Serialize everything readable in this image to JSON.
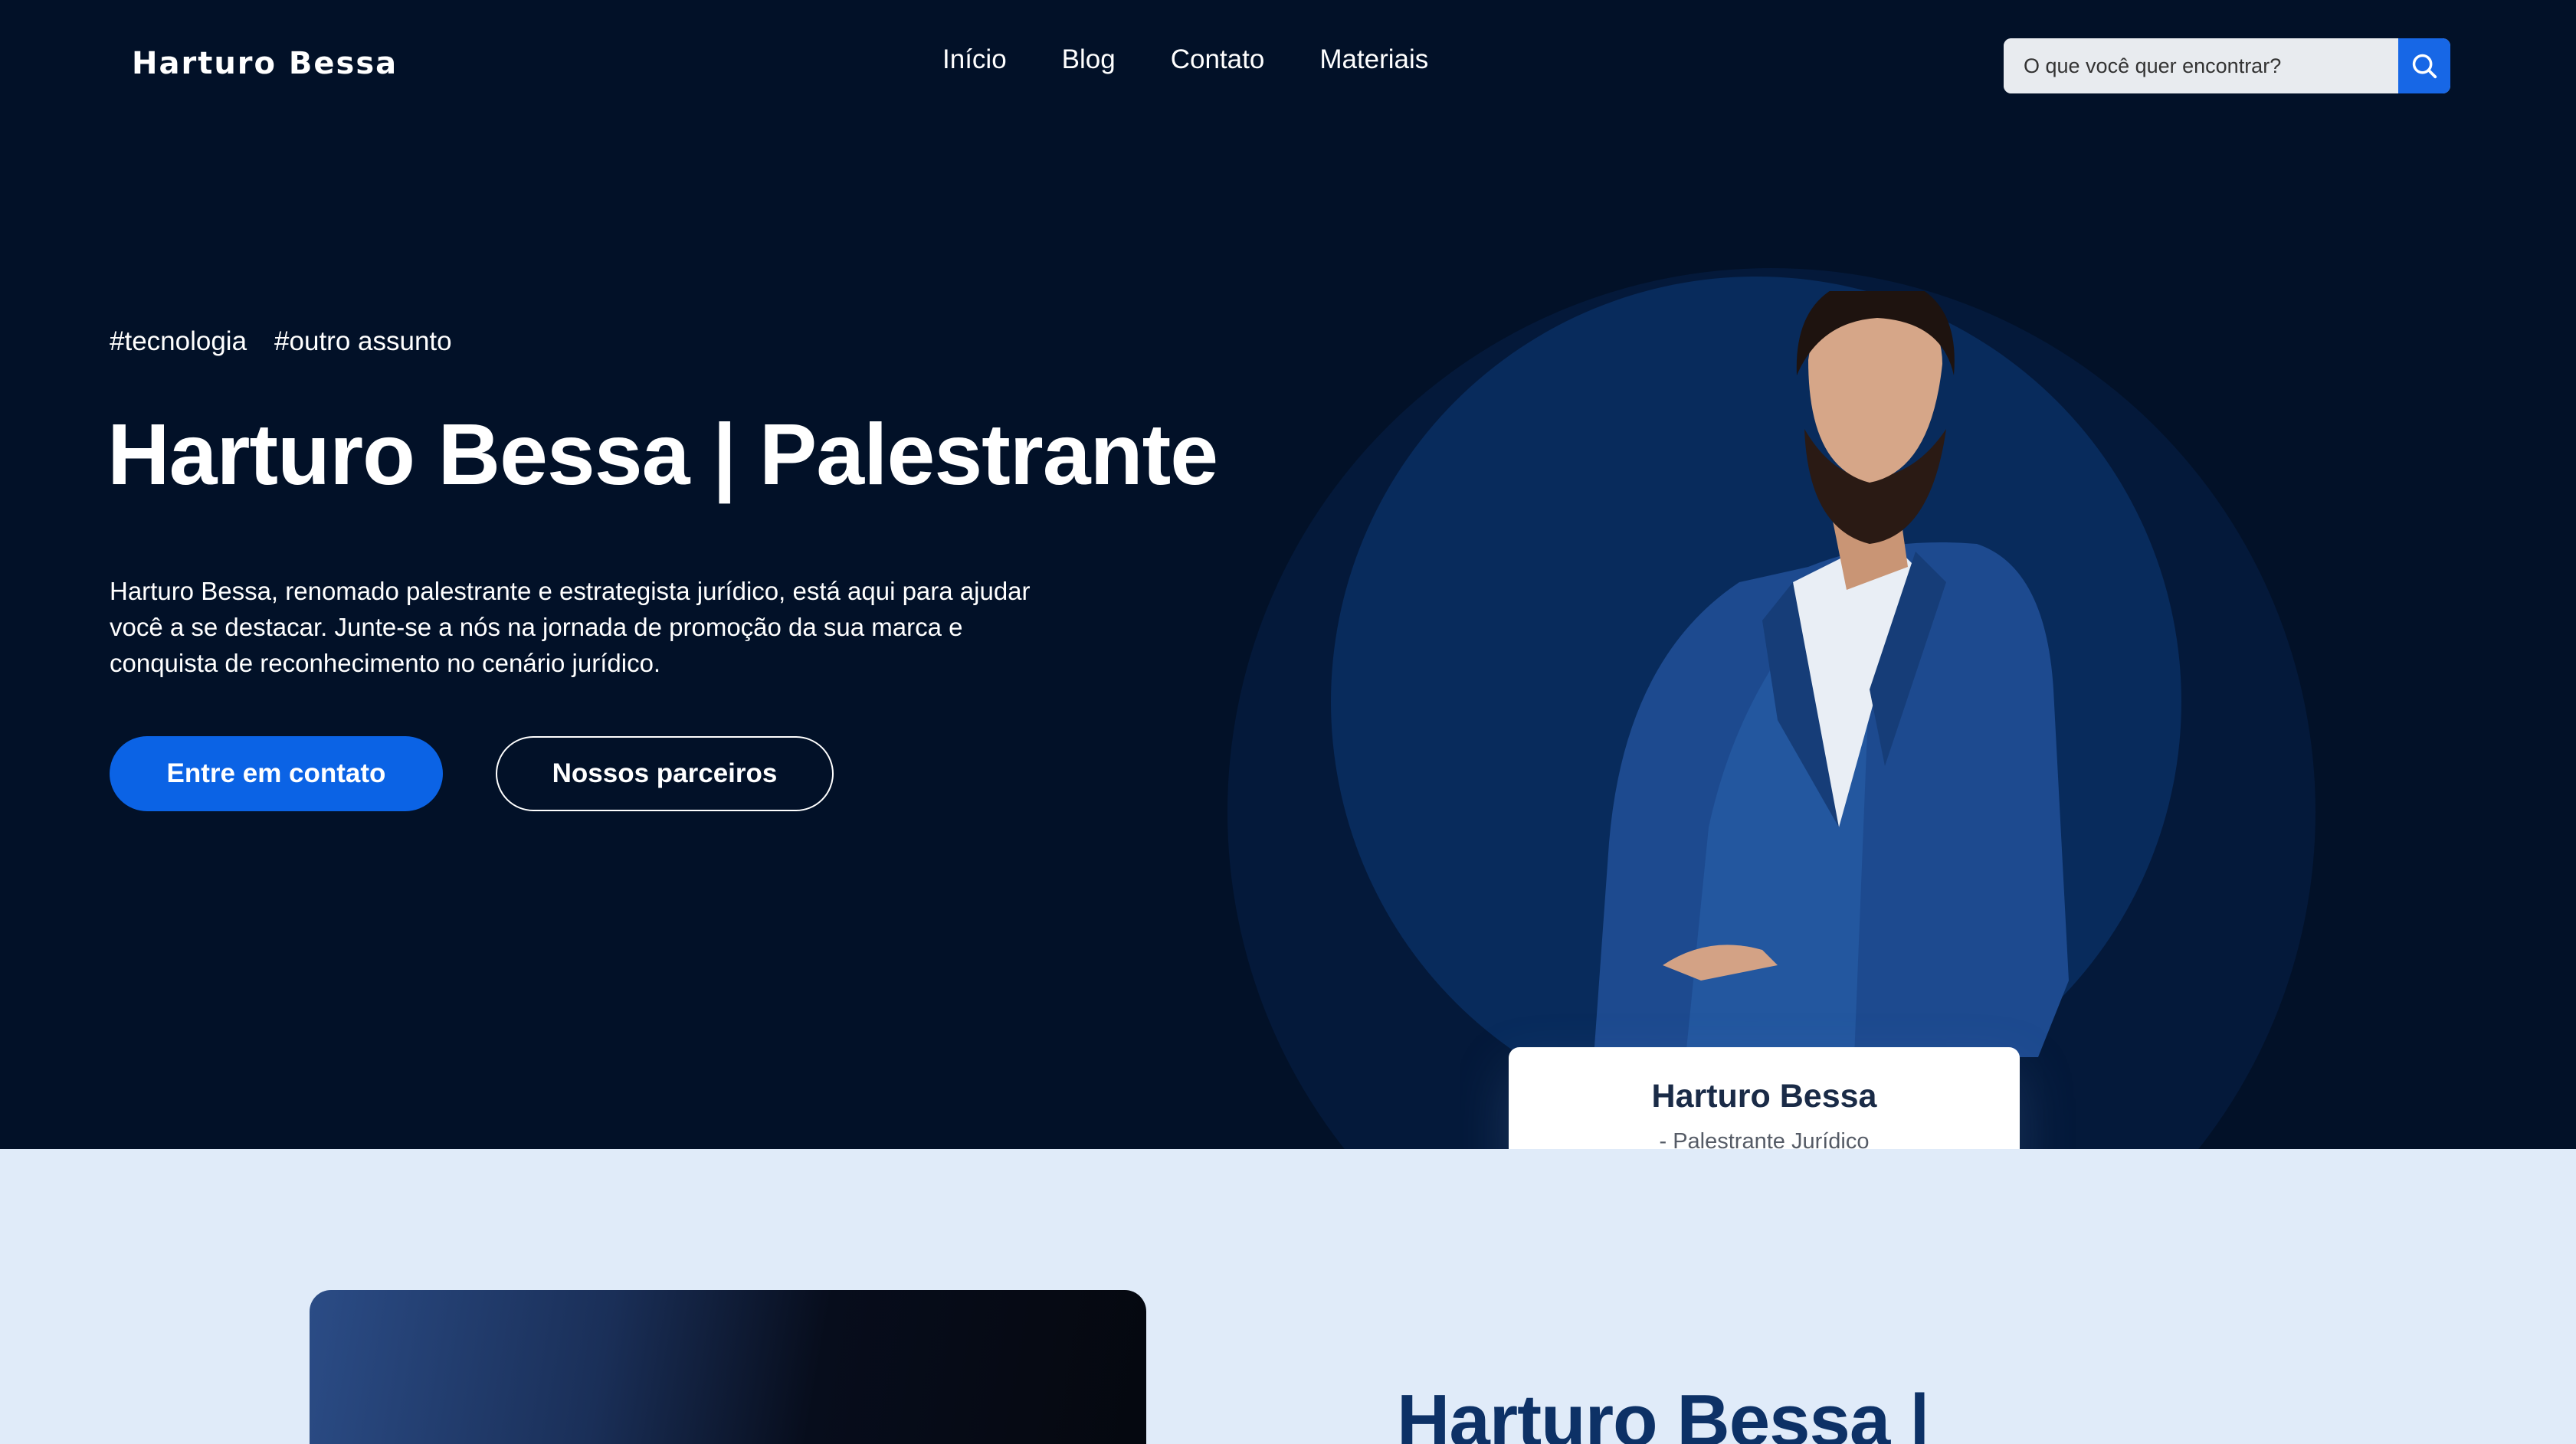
{
  "header": {
    "brand": "Harturo Bessa",
    "nav": [
      "Início",
      "Blog",
      "Contato",
      "Materiais"
    ],
    "search_placeholder": "O que você quer encontrar?",
    "search_icon": "search-icon"
  },
  "hero": {
    "tags": [
      "#tecnologia",
      "#outro assunto"
    ],
    "title": "Harturo Bessa | Palestrante",
    "description": "Harturo Bessa, renomado palestrante e estrategista jurídico, está aqui para ajudar você a se destacar. Junte-se a nós na jornada de promoção da sua marca e conquista de reconhecimento no cenário jurídico.",
    "cta_primary": "Entre em contato",
    "cta_secondary": "Nossos parceiros"
  },
  "profile_card": {
    "name": "Harturo Bessa",
    "role": "- Palestrante Jurídico"
  },
  "about": {
    "title": "Harturo Bessa |"
  },
  "colors": {
    "hero_bg": "#021128",
    "accent": "#0b63e5",
    "section_bg": "#e0ebf9",
    "title_dark": "#0d3166"
  }
}
